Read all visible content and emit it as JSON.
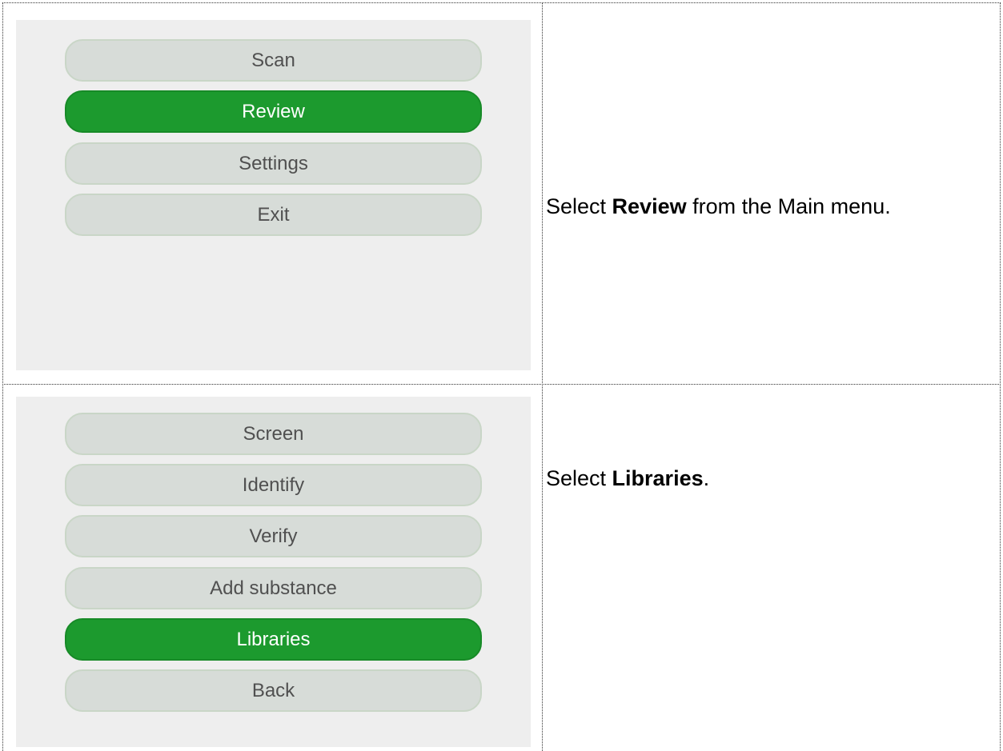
{
  "step1": {
    "menu": [
      {
        "label": "Scan",
        "selected": false
      },
      {
        "label": "Review",
        "selected": true
      },
      {
        "label": "Settings",
        "selected": false
      },
      {
        "label": "Exit",
        "selected": false
      }
    ],
    "instruction": {
      "prefix": "Select ",
      "bold": "Review",
      "suffix": " from the Main menu."
    }
  },
  "step2": {
    "menu": [
      {
        "label": "Screen",
        "selected": false
      },
      {
        "label": "Identify",
        "selected": false
      },
      {
        "label": "Verify",
        "selected": false
      },
      {
        "label": "Add substance",
        "selected": false
      },
      {
        "label": "Libraries",
        "selected": true
      },
      {
        "label": "Back",
        "selected": false
      }
    ],
    "instruction": {
      "prefix": "Select ",
      "bold": "Libraries",
      "suffix": "."
    }
  },
  "colors": {
    "selected_button": "#1c9a2e",
    "button": "#d7dcd8",
    "screen_background": "#eeeeee"
  }
}
